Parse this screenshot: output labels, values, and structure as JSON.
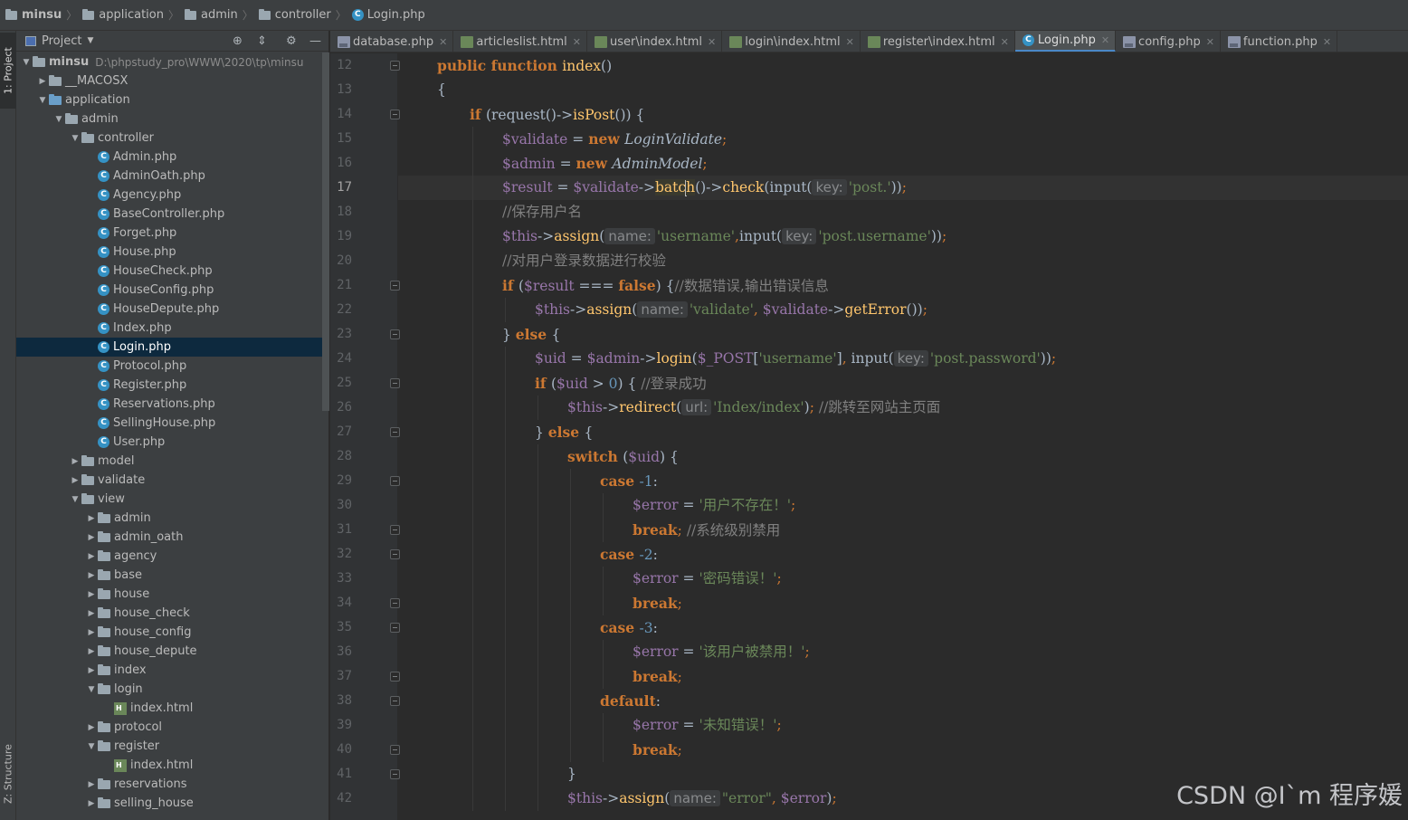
{
  "breadcrumb": [
    "minsu",
    "application",
    "admin",
    "controller",
    "Login.php"
  ],
  "side_tabs": {
    "project": "1: Project",
    "structure": "Z: Structure"
  },
  "project_panel": {
    "title": "Project",
    "root_path": "D:\\phpstudy_pro\\WWW\\2020\\tp\\minsu"
  },
  "tree": [
    {
      "label": "minsu",
      "depth": 0,
      "type": "folder",
      "open": true,
      "bold": true
    },
    {
      "label": "__MACOSX",
      "depth": 1,
      "type": "folder",
      "open": false
    },
    {
      "label": "application",
      "depth": 1,
      "type": "folder",
      "open": true
    },
    {
      "label": "admin",
      "depth": 2,
      "type": "folder",
      "open": true
    },
    {
      "label": "controller",
      "depth": 3,
      "type": "folder",
      "open": true
    },
    {
      "label": "Admin.php",
      "depth": 4,
      "type": "class"
    },
    {
      "label": "AdminOath.php",
      "depth": 4,
      "type": "class"
    },
    {
      "label": "Agency.php",
      "depth": 4,
      "type": "class"
    },
    {
      "label": "BaseController.php",
      "depth": 4,
      "type": "class"
    },
    {
      "label": "Forget.php",
      "depth": 4,
      "type": "class"
    },
    {
      "label": "House.php",
      "depth": 4,
      "type": "class"
    },
    {
      "label": "HouseCheck.php",
      "depth": 4,
      "type": "class"
    },
    {
      "label": "HouseConfig.php",
      "depth": 4,
      "type": "class"
    },
    {
      "label": "HouseDepute.php",
      "depth": 4,
      "type": "class"
    },
    {
      "label": "Index.php",
      "depth": 4,
      "type": "class"
    },
    {
      "label": "Login.php",
      "depth": 4,
      "type": "class",
      "selected": true
    },
    {
      "label": "Protocol.php",
      "depth": 4,
      "type": "class"
    },
    {
      "label": "Register.php",
      "depth": 4,
      "type": "class"
    },
    {
      "label": "Reservations.php",
      "depth": 4,
      "type": "class"
    },
    {
      "label": "SellingHouse.php",
      "depth": 4,
      "type": "class"
    },
    {
      "label": "User.php",
      "depth": 4,
      "type": "class"
    },
    {
      "label": "model",
      "depth": 3,
      "type": "folder",
      "open": false
    },
    {
      "label": "validate",
      "depth": 3,
      "type": "folder",
      "open": false
    },
    {
      "label": "view",
      "depth": 3,
      "type": "folder",
      "open": true
    },
    {
      "label": "admin",
      "depth": 4,
      "type": "folder",
      "open": false
    },
    {
      "label": "admin_oath",
      "depth": 4,
      "type": "folder",
      "open": false
    },
    {
      "label": "agency",
      "depth": 4,
      "type": "folder",
      "open": false
    },
    {
      "label": "base",
      "depth": 4,
      "type": "folder",
      "open": false
    },
    {
      "label": "house",
      "depth": 4,
      "type": "folder",
      "open": false
    },
    {
      "label": "house_check",
      "depth": 4,
      "type": "folder",
      "open": false
    },
    {
      "label": "house_config",
      "depth": 4,
      "type": "folder",
      "open": false
    },
    {
      "label": "house_depute",
      "depth": 4,
      "type": "folder",
      "open": false
    },
    {
      "label": "index",
      "depth": 4,
      "type": "folder",
      "open": false
    },
    {
      "label": "login",
      "depth": 4,
      "type": "folder",
      "open": true
    },
    {
      "label": "index.html",
      "depth": 5,
      "type": "html"
    },
    {
      "label": "protocol",
      "depth": 4,
      "type": "folder",
      "open": false
    },
    {
      "label": "register",
      "depth": 4,
      "type": "folder",
      "open": true
    },
    {
      "label": "index.html",
      "depth": 5,
      "type": "html"
    },
    {
      "label": "reservations",
      "depth": 4,
      "type": "folder",
      "open": false
    },
    {
      "label": "selling_house",
      "depth": 4,
      "type": "folder",
      "open": false
    }
  ],
  "tabs": [
    {
      "label": "database.php",
      "icon": "php"
    },
    {
      "label": "articleslist.html",
      "icon": "html"
    },
    {
      "label": "user\\index.html",
      "icon": "html"
    },
    {
      "label": "login\\index.html",
      "icon": "html"
    },
    {
      "label": "register\\index.html",
      "icon": "html"
    },
    {
      "label": "Login.php",
      "icon": "class",
      "active": true
    },
    {
      "label": "config.php",
      "icon": "php"
    },
    {
      "label": "function.php",
      "icon": "php"
    }
  ],
  "line_numbers": [
    "12",
    "13",
    "14",
    "15",
    "16",
    "17",
    "18",
    "19",
    "20",
    "21",
    "22",
    "23",
    "24",
    "25",
    "26",
    "27",
    "28",
    "29",
    "30",
    "31",
    "32",
    "33",
    "34",
    "35",
    "36",
    "37",
    "38",
    "39",
    "40",
    "41",
    "42"
  ],
  "current_line": "17",
  "code_lines": [
    {
      "indent": 1,
      "tokens": [
        [
          "kw",
          "public "
        ],
        [
          "kw",
          "function "
        ],
        [
          "fn",
          "index"
        ],
        [
          "p",
          "()"
        ]
      ]
    },
    {
      "indent": 1,
      "tokens": [
        [
          "p",
          "{"
        ]
      ]
    },
    {
      "indent": 2,
      "tokens": [
        [
          "kw",
          "if "
        ],
        [
          "p",
          "(request()->"
        ],
        [
          "fn",
          "isPost"
        ],
        [
          "p",
          "()) {"
        ]
      ]
    },
    {
      "indent": 3,
      "tokens": [
        [
          "var",
          "$validate"
        ],
        [
          "p",
          " = "
        ],
        [
          "kw",
          "new "
        ],
        [
          "cls",
          "LoginValidate"
        ],
        [
          "pun",
          ";"
        ]
      ]
    },
    {
      "indent": 3,
      "tokens": [
        [
          "var",
          "$admin"
        ],
        [
          "p",
          " = "
        ],
        [
          "kw",
          "new "
        ],
        [
          "cls",
          "AdminModel"
        ],
        [
          "pun",
          ";"
        ]
      ]
    },
    {
      "indent": 3,
      "tokens": [
        [
          "var",
          "$result"
        ],
        [
          "p",
          " = "
        ],
        [
          "var",
          "$validate"
        ],
        [
          "p",
          "->"
        ],
        [
          "fnhl",
          "batc"
        ],
        [
          "caret",
          ""
        ],
        [
          "fnhl",
          "h"
        ],
        [
          "p",
          "()->"
        ],
        [
          "fn",
          "check"
        ],
        [
          "p",
          "(input("
        ],
        [
          "hint",
          "key:"
        ],
        [
          "str",
          "'post.'"
        ],
        [
          "p",
          "))"
        ],
        [
          "pun",
          ";"
        ]
      ]
    },
    {
      "indent": 3,
      "tokens": [
        [
          "cm",
          "//保存用户名"
        ]
      ]
    },
    {
      "indent": 3,
      "tokens": [
        [
          "var",
          "$this"
        ],
        [
          "p",
          "->"
        ],
        [
          "fn",
          "assign"
        ],
        [
          "p",
          "("
        ],
        [
          "hint",
          "name:"
        ],
        [
          "str",
          "'username'"
        ],
        [
          "pun",
          ","
        ],
        [
          "p",
          "input("
        ],
        [
          "hint",
          "key:"
        ],
        [
          "str",
          "'post.username'"
        ],
        [
          "p",
          "))"
        ],
        [
          "pun",
          ";"
        ]
      ]
    },
    {
      "indent": 3,
      "tokens": [
        [
          "cm",
          "//对用户登录数据进行校验"
        ]
      ]
    },
    {
      "indent": 3,
      "tokens": [
        [
          "kw",
          "if "
        ],
        [
          "p",
          "("
        ],
        [
          "var",
          "$result"
        ],
        [
          "p",
          " === "
        ],
        [
          "kw",
          "false"
        ],
        [
          "p",
          ") {"
        ],
        [
          "cm",
          "//数据错误,输出错误信息"
        ]
      ]
    },
    {
      "indent": 4,
      "tokens": [
        [
          "var",
          "$this"
        ],
        [
          "p",
          "->"
        ],
        [
          "fn",
          "assign"
        ],
        [
          "p",
          "("
        ],
        [
          "hint",
          "name:"
        ],
        [
          "str",
          "'validate'"
        ],
        [
          "pun",
          ", "
        ],
        [
          "var",
          "$validate"
        ],
        [
          "p",
          "->"
        ],
        [
          "fn",
          "getError"
        ],
        [
          "p",
          "())"
        ],
        [
          "pun",
          ";"
        ]
      ]
    },
    {
      "indent": 3,
      "tokens": [
        [
          "p",
          "} "
        ],
        [
          "kw",
          "else "
        ],
        [
          "p",
          "{"
        ]
      ]
    },
    {
      "indent": 4,
      "tokens": [
        [
          "var",
          "$uid"
        ],
        [
          "p",
          " = "
        ],
        [
          "var",
          "$admin"
        ],
        [
          "p",
          "->"
        ],
        [
          "fn",
          "login"
        ],
        [
          "p",
          "("
        ],
        [
          "var",
          "$_POST"
        ],
        [
          "p",
          "["
        ],
        [
          "str",
          "'username'"
        ],
        [
          "p",
          "]"
        ],
        [
          "pun",
          ", "
        ],
        [
          "p",
          "input("
        ],
        [
          "hint",
          "key:"
        ],
        [
          "str",
          "'post.password'"
        ],
        [
          "p",
          "))"
        ],
        [
          "pun",
          ";"
        ]
      ]
    },
    {
      "indent": 4,
      "tokens": [
        [
          "kw",
          "if "
        ],
        [
          "p",
          "("
        ],
        [
          "var",
          "$uid"
        ],
        [
          "p",
          " > "
        ],
        [
          "num",
          "0"
        ],
        [
          "p",
          ") { "
        ],
        [
          "cm",
          "//登录成功"
        ]
      ]
    },
    {
      "indent": 5,
      "tokens": [
        [
          "var",
          "$this"
        ],
        [
          "p",
          "->"
        ],
        [
          "fn",
          "redirect"
        ],
        [
          "p",
          "("
        ],
        [
          "hint",
          "url:"
        ],
        [
          "str",
          "'Index/index'"
        ],
        [
          "p",
          ")"
        ],
        [
          "pun",
          "; "
        ],
        [
          "cm",
          "//跳转至网站主页面"
        ]
      ]
    },
    {
      "indent": 4,
      "tokens": [
        [
          "p",
          "} "
        ],
        [
          "kw",
          "else "
        ],
        [
          "p",
          "{"
        ]
      ]
    },
    {
      "indent": 5,
      "tokens": [
        [
          "kw",
          "switch "
        ],
        [
          "p",
          "("
        ],
        [
          "var",
          "$uid"
        ],
        [
          "p",
          ") {"
        ]
      ]
    },
    {
      "indent": 6,
      "tokens": [
        [
          "kw",
          "case "
        ],
        [
          "num",
          "-1"
        ],
        [
          "p",
          ":"
        ]
      ]
    },
    {
      "indent": 7,
      "tokens": [
        [
          "var",
          "$error"
        ],
        [
          "p",
          " = "
        ],
        [
          "str",
          "'用户不存在！'"
        ],
        [
          "pun",
          ";"
        ]
      ]
    },
    {
      "indent": 7,
      "tokens": [
        [
          "kw",
          "break"
        ],
        [
          "pun",
          "; "
        ],
        [
          "cm",
          "//系统级别禁用"
        ]
      ]
    },
    {
      "indent": 6,
      "tokens": [
        [
          "kw",
          "case "
        ],
        [
          "num",
          "-2"
        ],
        [
          "p",
          ":"
        ]
      ]
    },
    {
      "indent": 7,
      "tokens": [
        [
          "var",
          "$error"
        ],
        [
          "p",
          " = "
        ],
        [
          "str",
          "'密码错误！'"
        ],
        [
          "pun",
          ";"
        ]
      ]
    },
    {
      "indent": 7,
      "tokens": [
        [
          "kw",
          "break"
        ],
        [
          "pun",
          ";"
        ]
      ]
    },
    {
      "indent": 6,
      "tokens": [
        [
          "kw",
          "case "
        ],
        [
          "num",
          "-3"
        ],
        [
          "p",
          ":"
        ]
      ]
    },
    {
      "indent": 7,
      "tokens": [
        [
          "var",
          "$error"
        ],
        [
          "p",
          " = "
        ],
        [
          "str",
          "'该用户被禁用！'"
        ],
        [
          "pun",
          ";"
        ]
      ]
    },
    {
      "indent": 7,
      "tokens": [
        [
          "kw",
          "break"
        ],
        [
          "pun",
          ";"
        ]
      ]
    },
    {
      "indent": 6,
      "tokens": [
        [
          "kw",
          "default"
        ],
        [
          "p",
          ":"
        ]
      ]
    },
    {
      "indent": 7,
      "tokens": [
        [
          "var",
          "$error"
        ],
        [
          "p",
          " = "
        ],
        [
          "str",
          "'未知错误！'"
        ],
        [
          "pun",
          ";"
        ]
      ]
    },
    {
      "indent": 7,
      "tokens": [
        [
          "kw",
          "break"
        ],
        [
          "pun",
          ";"
        ]
      ]
    },
    {
      "indent": 5,
      "tokens": [
        [
          "p",
          "}"
        ]
      ]
    },
    {
      "indent": 5,
      "tokens": [
        [
          "var",
          "$this"
        ],
        [
          "p",
          "->"
        ],
        [
          "fn",
          "assign"
        ],
        [
          "p",
          "("
        ],
        [
          "hint",
          "name:"
        ],
        [
          "str",
          "\"error\""
        ],
        [
          "pun",
          ", "
        ],
        [
          "var",
          "$error"
        ],
        [
          "p",
          ")"
        ],
        [
          "pun",
          ";"
        ]
      ]
    }
  ],
  "watermark": "CSDN @I`m 程序媛"
}
